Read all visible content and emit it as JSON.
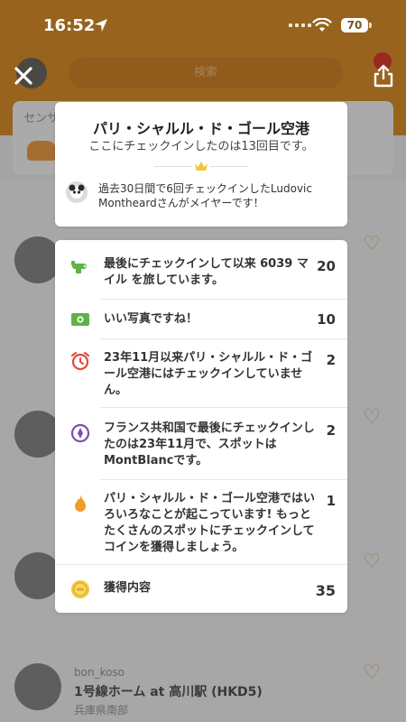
{
  "status": {
    "time": "16:52",
    "battery": "70"
  },
  "background": {
    "search_placeholder": "検索",
    "strip_text": "センサー",
    "feed": [
      {
        "line1": "",
        "line2": ""
      },
      {
        "line1": "",
        "line2": ""
      },
      {
        "line1": "",
        "line2": ""
      },
      {
        "line1": "bon_koso",
        "line2": "1号線ホーム at 高川駅 (HKD5)",
        "line3": "兵庫県南部"
      }
    ]
  },
  "venue": {
    "name": "パリ・シャルル・ド・ゴール空港",
    "visit_text": "ここにチェックインしたのは13回目です。",
    "mayor_text": "過去30日間で6回チェックインしたLudovic Montheardさんがメイヤーです！"
  },
  "rewards": [
    {
      "icon": "airplane-icon",
      "text": "最後にチェックインして以来 6039 マイル を旅しています。",
      "points": "20"
    },
    {
      "icon": "photo-icon",
      "text": "いい写真ですね！",
      "points": "10"
    },
    {
      "icon": "alarm-clock-icon",
      "text": "23年11月以来パリ・シャルル・ド・ゴール空港にはチェックインしていません。",
      "points": "2"
    },
    {
      "icon": "compass-icon",
      "text": "フランス共和国で最後にチェックインしたのは23年11月で、スポットはMontBlancです。",
      "points": "2"
    },
    {
      "icon": "flame-icon",
      "text": "パリ・シャルル・ド・ゴール空港ではいろいろなことが起こっています! もっとたくさんのスポットにチェックインしてコインを獲得しましょう。",
      "points": "1"
    }
  ],
  "total": {
    "label": "獲得内容",
    "points": "35"
  },
  "colors": {
    "accent": "#e0922a",
    "green": "#5fb246",
    "red": "#e14a3e",
    "purple": "#7a4fb2",
    "orange": "#f29b2c",
    "gold": "#f4c73b"
  }
}
